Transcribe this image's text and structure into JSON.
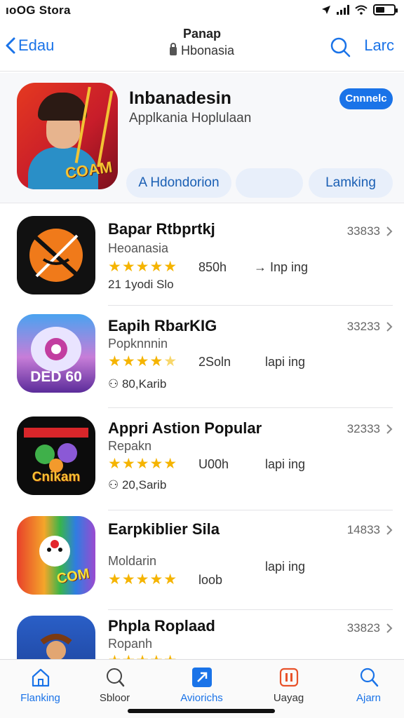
{
  "status_bar": {
    "carrier": "ıoOG Stora"
  },
  "nav": {
    "back_label": "Edau",
    "title": "Panap",
    "subtitle": "Hbonasia",
    "right_label": "Larc"
  },
  "featured": {
    "icon_text": "COAM",
    "title": "Inbanadesin",
    "subtitle": "Applkania Hoplulaan",
    "badge": "Cnnnelc",
    "chips": [
      "A Hdondorion",
      "",
      "Lamking"
    ]
  },
  "apps": [
    {
      "name": "Bapar Rtbprtkj",
      "sub": "Heoanasia",
      "rating": 5,
      "size": "850h",
      "action": "Inp ing",
      "extra": "21 1yodi Slo",
      "score": "33833",
      "icon_text": ""
    },
    {
      "name": "Eapih RbarKIG",
      "sub": "Popknnnin",
      "rating": 4.5,
      "size": "2Soln",
      "action": "lapi ing",
      "extra": "80,Karib",
      "score": "33233",
      "icon_text": "DED 60"
    },
    {
      "name": "Appri Astion Popular",
      "sub": "Repakn",
      "rating": 5,
      "size": "U00h",
      "action": "lapi ing",
      "extra": "20,Sarib",
      "score": "32333",
      "icon_text": "Cnikam"
    },
    {
      "name": "Earpkiblier Sila",
      "sub": "Moldarin",
      "rating": 5,
      "size": "loob",
      "action": "lapi ing",
      "extra": "",
      "score": "14833",
      "icon_text": "COM"
    },
    {
      "name": "Phpla Roplaad",
      "sub": "Ropanh",
      "rating": 5,
      "size": "",
      "action": "",
      "extra": "",
      "score": "33823",
      "icon_text": ""
    }
  ],
  "tabs": [
    {
      "label": "Flanking",
      "icon": "home-icon"
    },
    {
      "label": "Sbloor",
      "icon": "globe-icon"
    },
    {
      "label": "Aviorichs",
      "icon": "apps-icon"
    },
    {
      "label": "Uayag",
      "icon": "download-icon"
    },
    {
      "label": "Ajarn",
      "icon": "search-icon"
    }
  ],
  "colors": {
    "accent": "#1a73e8",
    "star": "#f5b400"
  }
}
